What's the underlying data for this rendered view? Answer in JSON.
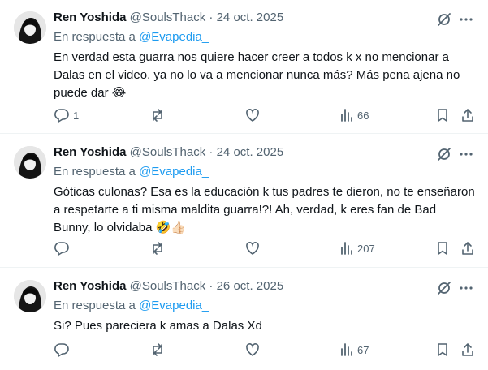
{
  "tweets": [
    {
      "name": "Ren Yoshida",
      "handle": "@SoulsThack",
      "separator": "·",
      "date": "24 oct. 2025",
      "reply_prefix": "En respuesta a",
      "reply_to": "@Evapedia_",
      "text": "En verdad esta guarra nos quiere hacer creer a todos k x no mencionar a Dalas en el video, ya no lo va a mencionar nunca más? Más pena ajena no puede dar",
      "emoji": "😂",
      "replies": "1",
      "reposts": "",
      "likes": "",
      "views": "66"
    },
    {
      "name": "Ren Yoshida",
      "handle": "@SoulsThack",
      "separator": "·",
      "date": "24 oct. 2025",
      "reply_prefix": "En respuesta a",
      "reply_to": "@Evapedia_",
      "text": "Góticas culonas? Esa es la educación k tus padres te dieron, no te enseñaron a respetarte a ti misma maldita guarra!?! Ah, verdad, k eres fan de Bad Bunny, lo olvidaba",
      "emoji": "🤣👍🏻",
      "replies": "",
      "reposts": "",
      "likes": "",
      "views": "207"
    },
    {
      "name": "Ren Yoshida",
      "handle": "@SoulsThack",
      "separator": "·",
      "date": "26 oct. 2025",
      "reply_prefix": "En respuesta a",
      "reply_to": "@Evapedia_",
      "text": "Si? Pues pareciera k amas a Dalas Xd",
      "emoji": "",
      "replies": "",
      "reposts": "",
      "likes": "",
      "views": "67"
    }
  ],
  "icons": [
    "avatar",
    "grok-icon",
    "more-icon",
    "reply-icon",
    "repost-icon",
    "like-icon",
    "views-icon",
    "bookmark-icon",
    "share-icon"
  ],
  "colors": {
    "text": "#0f1419",
    "muted": "#536471",
    "link": "#1d9bf0",
    "divider": "#eff3f4"
  }
}
